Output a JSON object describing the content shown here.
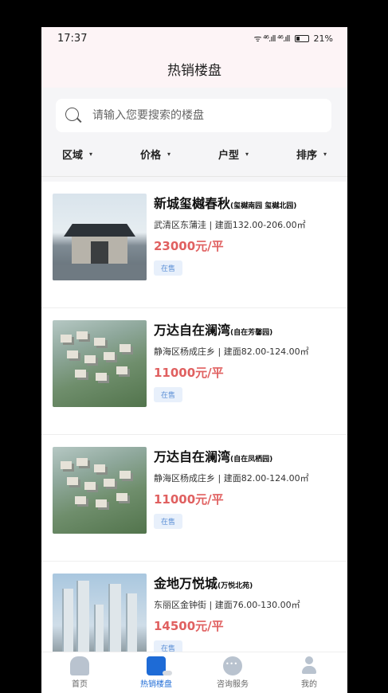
{
  "status_bar": {
    "time": "17:37",
    "signal": "ᯤ ⁴⁶.ıll ⁴⁶.ıll",
    "battery": "21%"
  },
  "header": {
    "title": "热销楼盘"
  },
  "search": {
    "placeholder": "请输入您要搜索的楼盘"
  },
  "filters": [
    {
      "label": "区域"
    },
    {
      "label": "价格"
    },
    {
      "label": "户型"
    },
    {
      "label": "排序"
    }
  ],
  "listings": [
    {
      "name": "新城玺樾春秋",
      "sub": "(玺樾南园 玺樾北园)",
      "location": "武清区东蒲洼 | 建面132.00-206.00㎡",
      "price": "23000元/平",
      "badge": "在售",
      "thumb": "villa"
    },
    {
      "name": "万达自在澜湾",
      "sub": "(自在芳馨园)",
      "location": "静海区杨成庄乡 | 建面82.00-124.00㎡",
      "price": "11000元/平",
      "badge": "在售",
      "thumb": "aerial"
    },
    {
      "name": "万达自在澜湾",
      "sub": "(自在凤栖园)",
      "location": "静海区杨成庄乡 | 建面82.00-124.00㎡",
      "price": "11000元/平",
      "badge": "在售",
      "thumb": "aerial"
    },
    {
      "name": "金地万悦城",
      "sub": "(万悦北苑)",
      "location": "东丽区金钟街 | 建面76.00-130.00㎡",
      "price": "14500元/平",
      "badge": "在售",
      "thumb": "tower"
    }
  ],
  "bottom_nav": [
    {
      "label": "首页",
      "icon": "home-icon"
    },
    {
      "label": "热销楼盘",
      "icon": "building-icon",
      "active": true
    },
    {
      "label": "咨询服务",
      "icon": "chat-icon"
    },
    {
      "label": "我的",
      "icon": "user-icon"
    }
  ],
  "colors": {
    "accent": "#1e6bd6",
    "price": "#e06060",
    "badge_bg": "#e8f0fb"
  }
}
